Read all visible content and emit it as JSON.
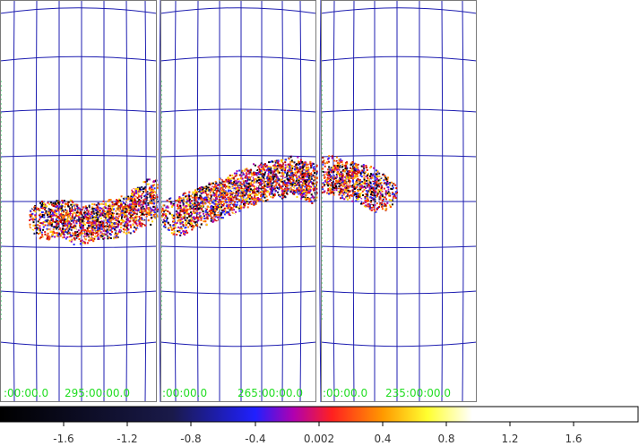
{
  "frames": [
    {
      "id": "frame-1",
      "x_labels": [
        ":00:00.0",
        "295:00:00.0"
      ],
      "blob_centers": [
        [
          52,
          245
        ],
        [
          70,
          243
        ],
        [
          88,
          251
        ],
        [
          106,
          247
        ],
        [
          122,
          244
        ],
        [
          140,
          238
        ],
        [
          158,
          230
        ],
        [
          170,
          220
        ]
      ]
    },
    {
      "id": "frame-2",
      "x_labels": [
        ":00:00.0",
        "265:00:00.0"
      ],
      "blob_centers": [
        [
          20,
          240
        ],
        [
          38,
          233
        ],
        [
          56,
          225
        ],
        [
          74,
          218
        ],
        [
          92,
          210
        ],
        [
          110,
          203
        ],
        [
          128,
          200
        ],
        [
          146,
          195
        ],
        [
          162,
          200
        ],
        [
          174,
          205
        ]
      ]
    },
    {
      "id": "frame-3",
      "x_labels": [
        ":00:00.0",
        "235:00:00.0"
      ],
      "blob_centers": [
        [
          10,
          195
        ],
        [
          28,
          200
        ],
        [
          46,
          205
        ],
        [
          62,
          214
        ]
      ]
    }
  ],
  "colorbar": {
    "tick_labels": [
      "-1.6",
      "-1.2",
      "-0.8",
      "-0.4",
      "0.002",
      "0.4",
      "0.8",
      "1.2",
      "1.6"
    ],
    "colormap": [
      "#000000",
      "#1a1a4a",
      "#2020ff",
      "#b000b0",
      "#ff2020",
      "#ff9900",
      "#ffff30",
      "#ffffff"
    ]
  }
}
